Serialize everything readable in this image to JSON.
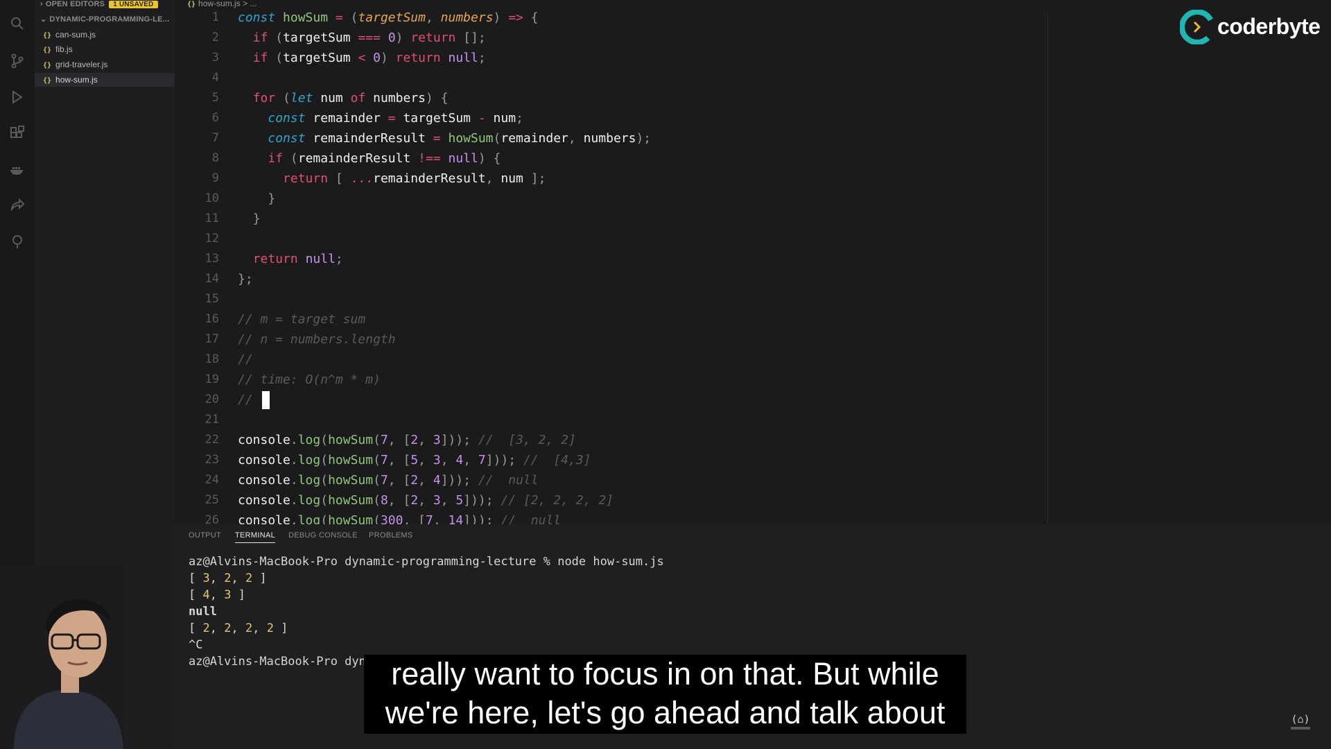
{
  "sidebar": {
    "open_editors_label": "OPEN EDITORS",
    "unsaved_badge": "1 UNSAVED",
    "folder_label": "DYNAMIC-PROGRAMMING-LE...",
    "file_icon": "{}",
    "files": [
      "can-sum.js",
      "fib.js",
      "grid-traveler.js",
      "how-sum.js"
    ]
  },
  "breadcrumb": {
    "icon": "{}",
    "file": "how-sum.js",
    "rest": "> ..."
  },
  "editor": {
    "lines": [
      {
        "n": "1",
        "code": "const howSum = (targetSum, numbers) => {"
      },
      {
        "n": "2",
        "code": "  if (targetSum === 0) return [];"
      },
      {
        "n": "3",
        "code": "  if (targetSum < 0) return null;"
      },
      {
        "n": "4",
        "code": ""
      },
      {
        "n": "5",
        "code": "  for (let num of numbers) {"
      },
      {
        "n": "6",
        "code": "    const remainder = targetSum - num;"
      },
      {
        "n": "7",
        "code": "    const remainderResult = howSum(remainder, numbers);"
      },
      {
        "n": "8",
        "code": "    if (remainderResult !== null) {"
      },
      {
        "n": "9",
        "code": "      return [ ...remainderResult, num ];"
      },
      {
        "n": "10",
        "code": "    }"
      },
      {
        "n": "11",
        "code": "  }"
      },
      {
        "n": "12",
        "code": ""
      },
      {
        "n": "13",
        "code": "  return null;"
      },
      {
        "n": "14",
        "code": "};"
      },
      {
        "n": "15",
        "code": ""
      },
      {
        "n": "16",
        "code": "// m = target sum"
      },
      {
        "n": "17",
        "code": "// n = numbers.length"
      },
      {
        "n": "18",
        "code": "//"
      },
      {
        "n": "19",
        "code": "// time: O(n^m * m)"
      },
      {
        "n": "20",
        "code": "// "
      },
      {
        "n": "21",
        "code": ""
      },
      {
        "n": "22",
        "code": "console.log(howSum(7, [2, 3])); //  [3, 2, 2]"
      },
      {
        "n": "23",
        "code": "console.log(howSum(7, [5, 3, 4, 7])); //  [4,3]"
      },
      {
        "n": "24",
        "code": "console.log(howSum(7, [2, 4])); //  null"
      },
      {
        "n": "25",
        "code": "console.log(howSum(8, [2, 3, 5])); // [2, 2, 2, 2]"
      },
      {
        "n": "26",
        "code": "console.log(howSum(300, [7, 14])); //  null"
      }
    ]
  },
  "panel": {
    "tabs": [
      "OUTPUT",
      "TERMINAL",
      "DEBUG CONSOLE",
      "PROBLEMS"
    ],
    "active_tab": "TERMINAL",
    "terminal": [
      "az@Alvins-MacBook-Pro dynamic-programming-lecture % node how-sum.js",
      "[ 3, 2, 2 ]",
      "[ 4, 3 ]",
      "null",
      "[ 2, 2, 2, 2 ]",
      "^C",
      "az@Alvins-MacBook-Pro dynamic-programming-lecture % "
    ]
  },
  "caption": {
    "line1": "really want to focus in on that. But while",
    "line2": "we're here, let's go ahead and talk about"
  },
  "logo": {
    "text": "coderbyte"
  },
  "colors": {
    "keyword": "#e0506f",
    "storage": "#2fa7c8",
    "function": "#8fc97a",
    "variable": "#f0f0f0",
    "param": "#e6a64c",
    "number": "#c792ea",
    "comment": "#5a5a5a",
    "logo_accent": "#1fb5b0"
  }
}
